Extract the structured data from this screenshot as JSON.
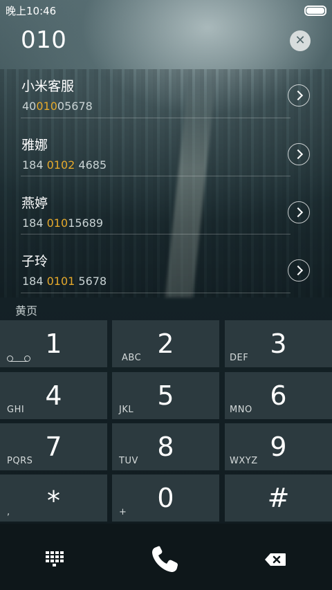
{
  "status_bar": {
    "time": "晚上10:46",
    "battery_level": 1.0
  },
  "dialer": {
    "input_value": "010"
  },
  "contacts": [
    {
      "name": "小米客服",
      "number_pre": "40",
      "number_match": "010",
      "number_post": "05678"
    },
    {
      "name": "雅娜",
      "number_pre": "184 ",
      "number_match": "0102",
      "number_post": " 4685"
    },
    {
      "name": "燕婷",
      "number_pre": "184 ",
      "number_match": "010",
      "number_post": "15689"
    },
    {
      "name": "子玲",
      "number_pre": "184 ",
      "number_match": "0101",
      "number_post": " 5678"
    }
  ],
  "section_label": "黄页",
  "keypad": [
    {
      "digit": "1",
      "letters": ""
    },
    {
      "digit": "2",
      "letters": "ABC"
    },
    {
      "digit": "3",
      "letters": "DEF"
    },
    {
      "digit": "4",
      "letters": "GHI"
    },
    {
      "digit": "5",
      "letters": "JKL"
    },
    {
      "digit": "6",
      "letters": "MNO"
    },
    {
      "digit": "7",
      "letters": "PQRS"
    },
    {
      "digit": "8",
      "letters": "TUV"
    },
    {
      "digit": "9",
      "letters": "WXYZ"
    },
    {
      "digit": "*",
      "letters": ","
    },
    {
      "digit": "0",
      "letters": "+"
    },
    {
      "digit": "#",
      "letters": ""
    }
  ],
  "icons": {
    "clear": "clear-icon",
    "arrow": "chevron-right-icon",
    "voicemail": "voicemail-icon",
    "dialpad": "dialpad-icon",
    "call": "phone-icon",
    "backspace": "backspace-icon"
  },
  "colors": {
    "highlight": "#e5a92b",
    "key_bg": "#2c3a3f",
    "bottom_bg": "#0e171a"
  }
}
